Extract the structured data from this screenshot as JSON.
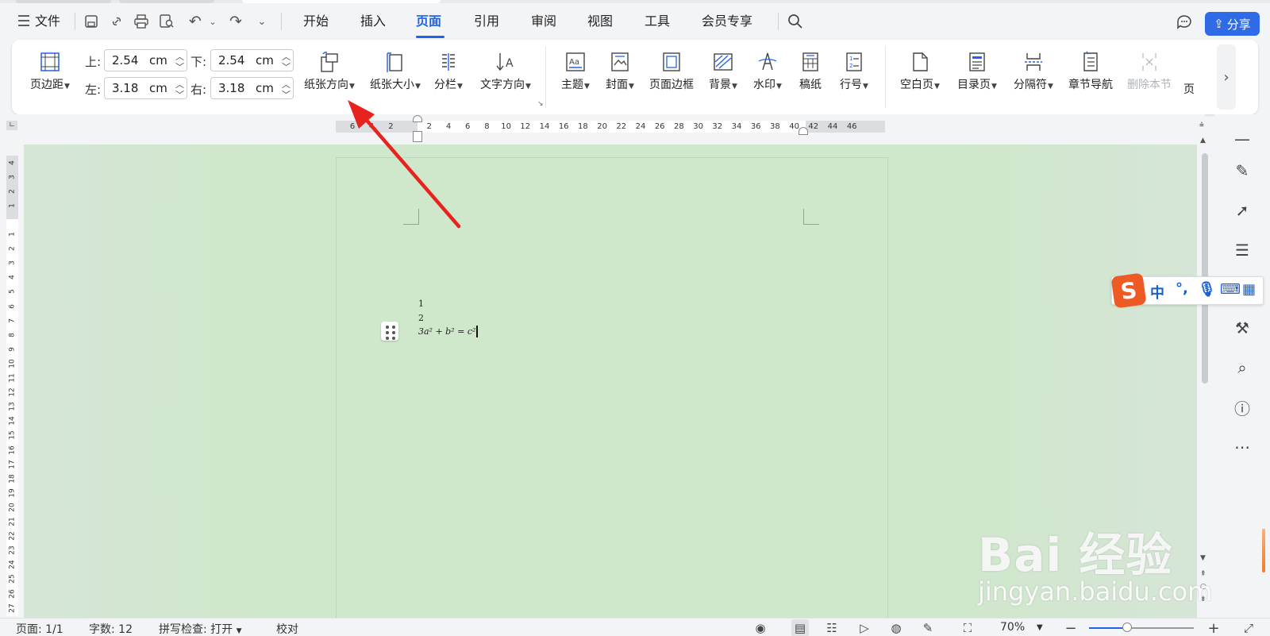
{
  "menubar": {
    "menu_icon": "hamburger-icon",
    "file": "文件",
    "tabs": [
      "开始",
      "插入",
      "页面",
      "引用",
      "审阅",
      "视图",
      "工具",
      "会员专享"
    ],
    "active_tab": "页面",
    "share": "分享"
  },
  "ribbon": {
    "margins": {
      "label": "页边距",
      "top_label": "上:",
      "top_value": "2.54",
      "top_unit": "cm",
      "bottom_label": "下:",
      "bottom_value": "2.54",
      "bottom_unit": "cm",
      "left_label": "左:",
      "left_value": "3.18",
      "left_unit": "cm",
      "right_label": "右:",
      "right_value": "3.18",
      "right_unit": "cm"
    },
    "orientation": "纸张方向",
    "size": "纸张大小",
    "columns": "分栏",
    "text_direction": "文字方向",
    "theme": "主题",
    "cover": "封面",
    "page_border": "页面边框",
    "background": "背景",
    "watermark": "水印",
    "manuscript": "稿纸",
    "line_number": "行号",
    "blank_page": "空白页",
    "toc_page": "目录页",
    "separator": "分隔符",
    "chapter_nav": "章节导航",
    "delete_section": "删除本节",
    "cut_label": "页"
  },
  "ruler": {
    "h_numbers": [
      "6",
      "4",
      "2",
      "2",
      "4",
      "6",
      "8",
      "10",
      "12",
      "14",
      "16",
      "18",
      "20",
      "22",
      "24",
      "26",
      "28",
      "30",
      "32",
      "34",
      "36",
      "38",
      "40",
      "42",
      "44",
      "46"
    ],
    "v_numbers_top": [
      "4",
      "3",
      "2",
      "1"
    ],
    "v_numbers": [
      "1",
      "2",
      "3",
      "4",
      "5",
      "6",
      "7",
      "8",
      "9",
      "10",
      "11",
      "12",
      "13",
      "14",
      "15",
      "16",
      "17",
      "18",
      "19",
      "20",
      "21",
      "22",
      "23",
      "24",
      "25",
      "26",
      "27"
    ]
  },
  "document": {
    "line1": "1",
    "line2": "2",
    "line3": "3a² + b² = c²"
  },
  "ime": {
    "logo": "S",
    "chinese": "中"
  },
  "statusbar": {
    "page": "页面: 1/1",
    "words": "字数: 12",
    "spell": "拼写检查: 打开",
    "proof": "校对",
    "zoom": "70%"
  },
  "watermark_text": {
    "brand": "Bai 经验",
    "url": "jingyan.baidu.com"
  },
  "colors": {
    "accent": "#1e63e9",
    "page_bg": "#cfe7cb",
    "arrow": "#e8231f"
  }
}
